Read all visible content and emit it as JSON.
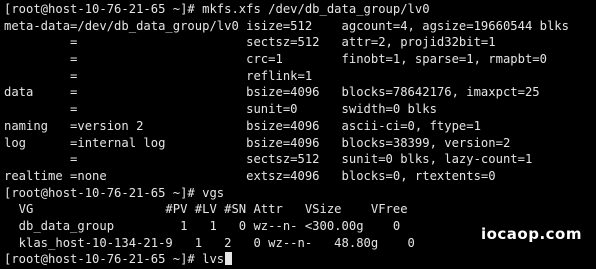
{
  "terminal": {
    "lines": [
      "[root@host-10-76-21-65 ~]# mkfs.xfs /dev/db_data_group/lv0",
      "meta-data=/dev/db_data_group/lv0 isize=512    agcount=4, agsize=19660544 blks",
      "         =                       sectsz=512   attr=2, projid32bit=1",
      "         =                       crc=1        finobt=1, sparse=1, rmapbt=0",
      "         =                       reflink=1",
      "data     =                       bsize=4096   blocks=78642176, imaxpct=25",
      "         =                       sunit=0      swidth=0 blks",
      "naming   =version 2              bsize=4096   ascii-ci=0, ftype=1",
      "log      =internal log           bsize=4096   blocks=38399, version=2",
      "         =                       sectsz=512   sunit=0 blks, lazy-count=1",
      "realtime =none                   extsz=4096   blocks=0, rtextents=0",
      "[root@host-10-76-21-65 ~]# vgs",
      "  VG                  #PV #LV #SN Attr   VSize    VFree",
      "  db_data_group         1   1   0 wz--n- <300.00g    0",
      "  klas_host-10-134-21-9   1   2   0 wz--n-   48.80g    0",
      "[root@host-10-76-21-65 ~]# lvs"
    ]
  },
  "watermark": {
    "text": "iocaop.com"
  },
  "colors": {
    "background": "#000000",
    "text": "#e6e6e6"
  }
}
